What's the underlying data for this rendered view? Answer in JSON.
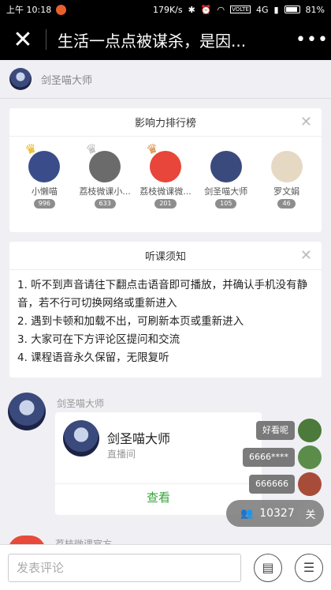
{
  "status_bar": {
    "time": "上午 10:18",
    "speed": "179K/s",
    "network": "4G",
    "battery": "81%",
    "volte": "VOLTE"
  },
  "title_bar": {
    "title": "生活一点点被谋杀，是因...",
    "close_icon": "close-icon",
    "more_icon": "more-icon"
  },
  "host": {
    "name": "剑圣喵大师"
  },
  "ranking": {
    "title": "影响力排行榜",
    "items": [
      {
        "name": "小懒喵",
        "count": "996",
        "crown": "gold",
        "color": "#3a4d8a"
      },
      {
        "name": "荔枝微课小...",
        "count": "633",
        "crown": "silver",
        "color": "#6b6b6b"
      },
      {
        "name": "荔枝微课微...",
        "count": "201",
        "crown": "bronze",
        "color": "#e8463a"
      },
      {
        "name": "剑圣喵大师",
        "count": "105",
        "crown": "",
        "color": "#3b4a7c"
      },
      {
        "name": "罗文娟",
        "count": "46",
        "crown": "",
        "color": "#e6d9c4"
      }
    ]
  },
  "notice": {
    "title": "听课须知",
    "lines": [
      "1. 听不到声音请往下翻点击语音即可播放，并确认手机没有静音，若不行可切换网络或重新进入",
      "2. 遇到卡顿和加载不出，可刷新本页或重新进入",
      "3. 大家可在下方评论区提问和交流",
      "4. 课程语音永久保留，无限复听"
    ]
  },
  "message": {
    "sender": "剑圣喵大师",
    "card_name": "剑圣喵大师",
    "card_sub": "直播间",
    "card_action": "查看"
  },
  "next_sender": "荔枝微课官方",
  "danmaku": [
    {
      "text": "好看呢"
    },
    {
      "text": "6666****"
    },
    {
      "text": "666666"
    }
  ],
  "online": {
    "count": "10327",
    "follow_label": "关"
  },
  "bottom": {
    "placeholder": "发表评论"
  }
}
